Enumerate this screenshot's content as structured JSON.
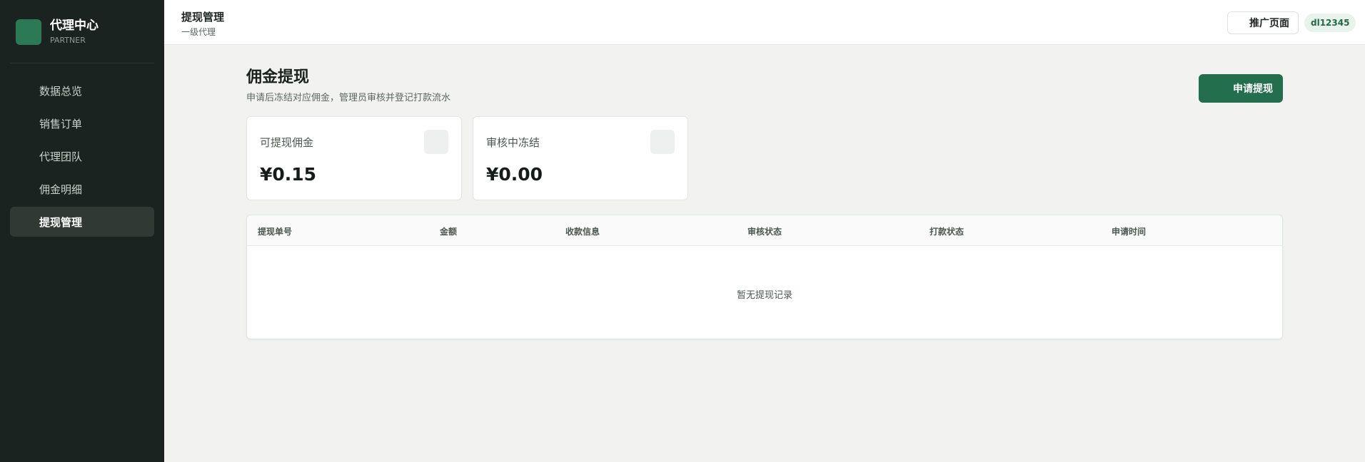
{
  "sidebar": {
    "brand_title": "代理中心",
    "brand_sub": "PARTNER",
    "items": [
      {
        "label": "数据总览"
      },
      {
        "label": "销售订单"
      },
      {
        "label": "代理团队"
      },
      {
        "label": "佣金明细"
      },
      {
        "label": "提现管理"
      }
    ],
    "active_index": 4
  },
  "header": {
    "title": "提现管理",
    "subtitle": "一级代理",
    "promo_label": "推广页面",
    "user": "dl12345"
  },
  "main": {
    "title": "佣金提现",
    "description": "申请后冻结对应佣金，管理员审核并登记打款流水",
    "apply_label": "申请提现",
    "stats": [
      {
        "label": "可提现佣金",
        "value": "¥0.15"
      },
      {
        "label": "审核中冻结",
        "value": "¥0.00"
      }
    ],
    "table": {
      "columns": [
        "提现单号",
        "金额",
        "收款信息",
        "审核状态",
        "打款状态",
        "申请时间"
      ],
      "empty_text": "暂无提现记录"
    }
  },
  "colors": {
    "sidebar_bg": "#1b2320",
    "accent": "#236e4d",
    "page_bg": "#f2f3f1"
  }
}
